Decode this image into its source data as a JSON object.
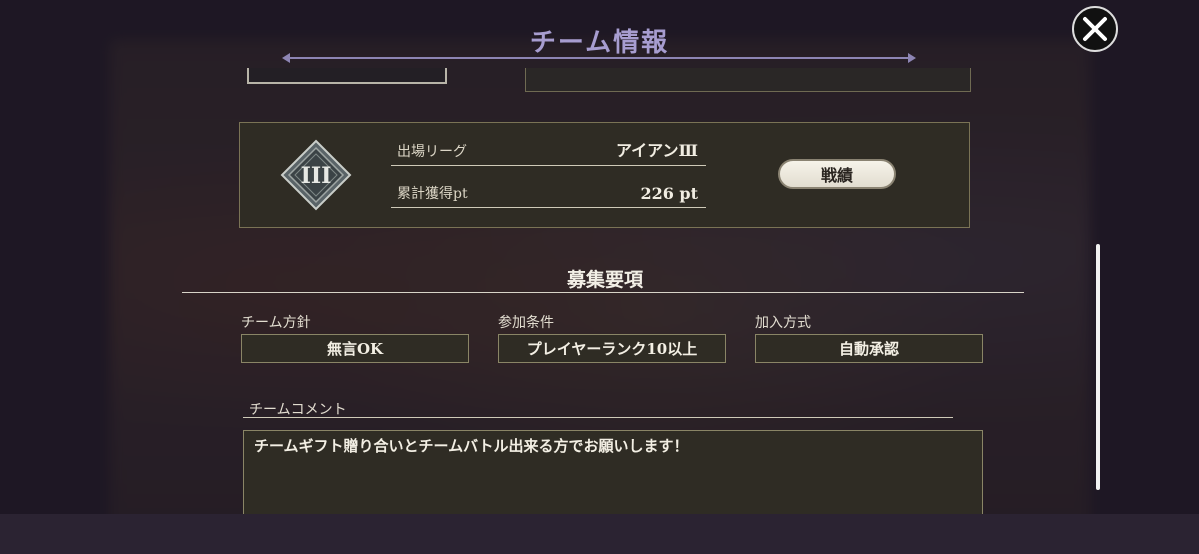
{
  "header": {
    "title": "チーム情報"
  },
  "league": {
    "emblem_numeral": "III",
    "league_label": "出場リーグ",
    "league_value": "アイアンⅢ",
    "points_label": "累計獲得pt",
    "points_value": "226 pt",
    "record_button": "戦績"
  },
  "recruitment": {
    "section_title": "募集要項",
    "fields": [
      {
        "label": "チーム方針",
        "value": "無言OK"
      },
      {
        "label": "参加条件",
        "value": "プレイヤーランク10以上"
      },
      {
        "label": "加入方式",
        "value": "自動承認"
      }
    ]
  },
  "comment": {
    "label": "チームコメント",
    "text": "チームギフト贈り合いとチームバトル出来る方でお願いします！"
  },
  "icons": {
    "close": "close-icon",
    "emblem": "league-emblem-icon"
  },
  "colors": {
    "title": "#a79dd0",
    "panel": "#2f2c24",
    "panel_border": "#8a8566",
    "backdrop": "#2b2332"
  }
}
